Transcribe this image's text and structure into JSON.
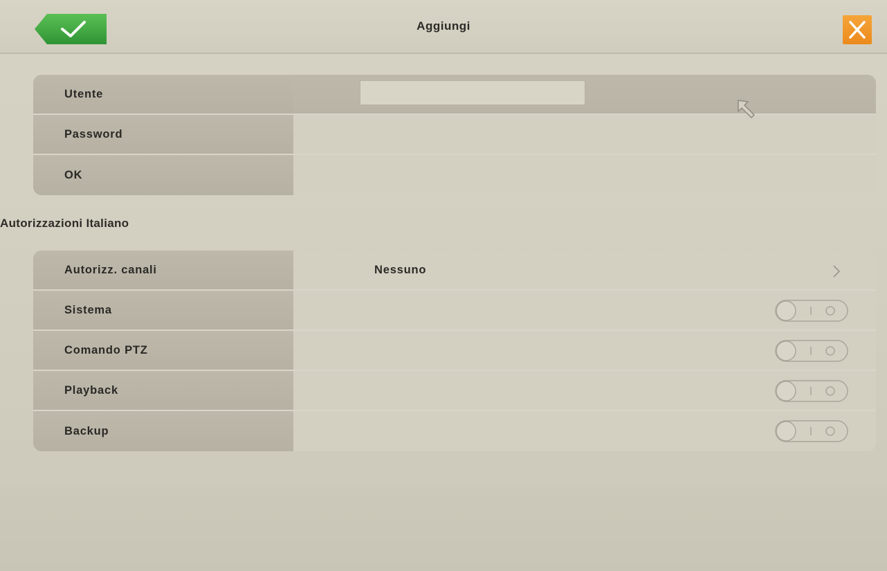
{
  "header": {
    "title": "Aggiungi",
    "confirm_icon": "checkmark-icon",
    "close_icon": "close-icon",
    "confirm_color": "#3fa53f",
    "close_color": "#ec8a1c"
  },
  "account": {
    "rows": [
      {
        "label": "Utente",
        "value": ""
      },
      {
        "label": "Password",
        "value": ""
      },
      {
        "label": "OK",
        "value": ""
      }
    ]
  },
  "permissions": {
    "section_title": "Autorizzazioni Italiano",
    "channel": {
      "label": "Autorizz. canali",
      "value": "Nessuno"
    },
    "toggles": [
      {
        "label": "Sistema",
        "enabled": false
      },
      {
        "label": "Comando PTZ",
        "enabled": false
      },
      {
        "label": "Playback",
        "enabled": false
      },
      {
        "label": "Backup",
        "enabled": false
      }
    ]
  }
}
